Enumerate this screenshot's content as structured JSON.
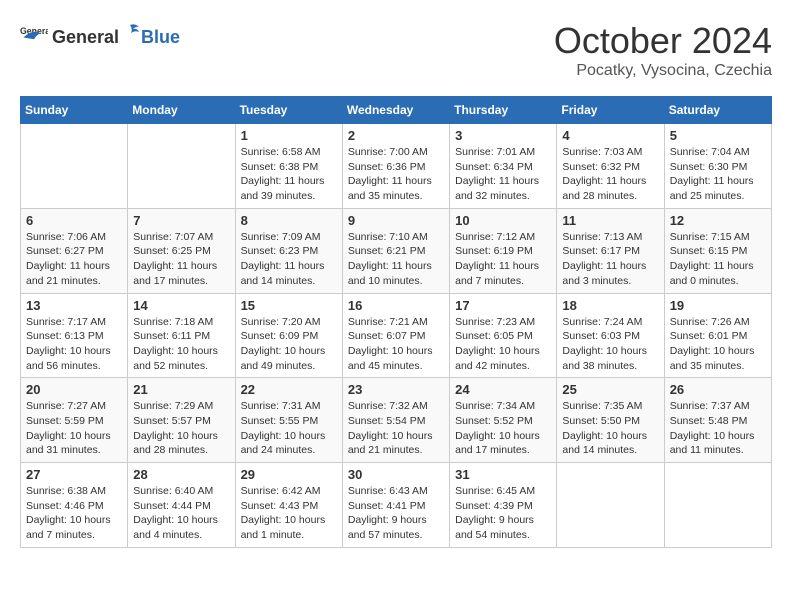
{
  "header": {
    "logo_general": "General",
    "logo_blue": "Blue",
    "month": "October 2024",
    "location": "Pocatky, Vysocina, Czechia"
  },
  "days_of_week": [
    "Sunday",
    "Monday",
    "Tuesday",
    "Wednesday",
    "Thursday",
    "Friday",
    "Saturday"
  ],
  "weeks": [
    [
      {
        "day": "",
        "content": ""
      },
      {
        "day": "",
        "content": ""
      },
      {
        "day": "1",
        "content": "Sunrise: 6:58 AM\nSunset: 6:38 PM\nDaylight: 11 hours and 39 minutes."
      },
      {
        "day": "2",
        "content": "Sunrise: 7:00 AM\nSunset: 6:36 PM\nDaylight: 11 hours and 35 minutes."
      },
      {
        "day": "3",
        "content": "Sunrise: 7:01 AM\nSunset: 6:34 PM\nDaylight: 11 hours and 32 minutes."
      },
      {
        "day": "4",
        "content": "Sunrise: 7:03 AM\nSunset: 6:32 PM\nDaylight: 11 hours and 28 minutes."
      },
      {
        "day": "5",
        "content": "Sunrise: 7:04 AM\nSunset: 6:30 PM\nDaylight: 11 hours and 25 minutes."
      }
    ],
    [
      {
        "day": "6",
        "content": "Sunrise: 7:06 AM\nSunset: 6:27 PM\nDaylight: 11 hours and 21 minutes."
      },
      {
        "day": "7",
        "content": "Sunrise: 7:07 AM\nSunset: 6:25 PM\nDaylight: 11 hours and 17 minutes."
      },
      {
        "day": "8",
        "content": "Sunrise: 7:09 AM\nSunset: 6:23 PM\nDaylight: 11 hours and 14 minutes."
      },
      {
        "day": "9",
        "content": "Sunrise: 7:10 AM\nSunset: 6:21 PM\nDaylight: 11 hours and 10 minutes."
      },
      {
        "day": "10",
        "content": "Sunrise: 7:12 AM\nSunset: 6:19 PM\nDaylight: 11 hours and 7 minutes."
      },
      {
        "day": "11",
        "content": "Sunrise: 7:13 AM\nSunset: 6:17 PM\nDaylight: 11 hours and 3 minutes."
      },
      {
        "day": "12",
        "content": "Sunrise: 7:15 AM\nSunset: 6:15 PM\nDaylight: 11 hours and 0 minutes."
      }
    ],
    [
      {
        "day": "13",
        "content": "Sunrise: 7:17 AM\nSunset: 6:13 PM\nDaylight: 10 hours and 56 minutes."
      },
      {
        "day": "14",
        "content": "Sunrise: 7:18 AM\nSunset: 6:11 PM\nDaylight: 10 hours and 52 minutes."
      },
      {
        "day": "15",
        "content": "Sunrise: 7:20 AM\nSunset: 6:09 PM\nDaylight: 10 hours and 49 minutes."
      },
      {
        "day": "16",
        "content": "Sunrise: 7:21 AM\nSunset: 6:07 PM\nDaylight: 10 hours and 45 minutes."
      },
      {
        "day": "17",
        "content": "Sunrise: 7:23 AM\nSunset: 6:05 PM\nDaylight: 10 hours and 42 minutes."
      },
      {
        "day": "18",
        "content": "Sunrise: 7:24 AM\nSunset: 6:03 PM\nDaylight: 10 hours and 38 minutes."
      },
      {
        "day": "19",
        "content": "Sunrise: 7:26 AM\nSunset: 6:01 PM\nDaylight: 10 hours and 35 minutes."
      }
    ],
    [
      {
        "day": "20",
        "content": "Sunrise: 7:27 AM\nSunset: 5:59 PM\nDaylight: 10 hours and 31 minutes."
      },
      {
        "day": "21",
        "content": "Sunrise: 7:29 AM\nSunset: 5:57 PM\nDaylight: 10 hours and 28 minutes."
      },
      {
        "day": "22",
        "content": "Sunrise: 7:31 AM\nSunset: 5:55 PM\nDaylight: 10 hours and 24 minutes."
      },
      {
        "day": "23",
        "content": "Sunrise: 7:32 AM\nSunset: 5:54 PM\nDaylight: 10 hours and 21 minutes."
      },
      {
        "day": "24",
        "content": "Sunrise: 7:34 AM\nSunset: 5:52 PM\nDaylight: 10 hours and 17 minutes."
      },
      {
        "day": "25",
        "content": "Sunrise: 7:35 AM\nSunset: 5:50 PM\nDaylight: 10 hours and 14 minutes."
      },
      {
        "day": "26",
        "content": "Sunrise: 7:37 AM\nSunset: 5:48 PM\nDaylight: 10 hours and 11 minutes."
      }
    ],
    [
      {
        "day": "27",
        "content": "Sunrise: 6:38 AM\nSunset: 4:46 PM\nDaylight: 10 hours and 7 minutes."
      },
      {
        "day": "28",
        "content": "Sunrise: 6:40 AM\nSunset: 4:44 PM\nDaylight: 10 hours and 4 minutes."
      },
      {
        "day": "29",
        "content": "Sunrise: 6:42 AM\nSunset: 4:43 PM\nDaylight: 10 hours and 1 minute."
      },
      {
        "day": "30",
        "content": "Sunrise: 6:43 AM\nSunset: 4:41 PM\nDaylight: 9 hours and 57 minutes."
      },
      {
        "day": "31",
        "content": "Sunrise: 6:45 AM\nSunset: 4:39 PM\nDaylight: 9 hours and 54 minutes."
      },
      {
        "day": "",
        "content": ""
      },
      {
        "day": "",
        "content": ""
      }
    ]
  ]
}
